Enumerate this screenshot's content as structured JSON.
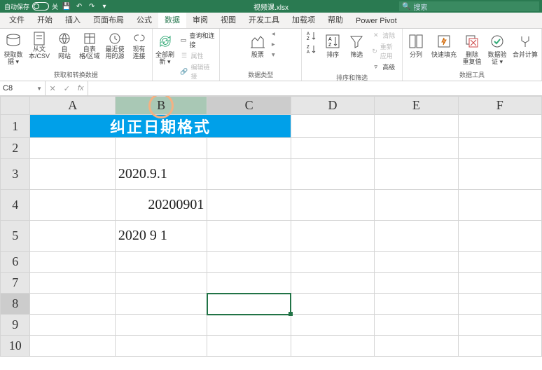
{
  "titlebar": {
    "autosave_label": "自动保存",
    "autosave_state": "关",
    "filename": "视频课.xlsx",
    "search_placeholder": "搜索"
  },
  "tabs": {
    "file": "文件",
    "home": "开始",
    "insert": "插入",
    "layout": "页面布局",
    "formulas": "公式",
    "data": "数据",
    "review": "审阅",
    "view": "视图",
    "dev": "开发工具",
    "addins": "加载项",
    "help": "帮助",
    "powerpivot": "Power Pivot"
  },
  "ribbon": {
    "group1": {
      "get_data": "获取数\n据 ▾",
      "from_csv": "从文\n本/CSV",
      "from_web": "自\n网站",
      "from_table": "自表\n格/区域",
      "recent": "最近使\n用的源",
      "existing": "现有\n连接",
      "label": "获取和转换数据"
    },
    "group2": {
      "refresh": "全部刷\n新 ▾",
      "queries": "查询和连接",
      "properties": "属性",
      "edit_links": "编辑链接",
      "label": "查询和连接"
    },
    "group3": {
      "stocks": "股票",
      "label": "数据类型"
    },
    "group4": {
      "sort_asc": "A↓Z",
      "sort_desc": "Z↓A",
      "sort": "排序",
      "filter": "筛选",
      "clear": "清除",
      "reapply": "重新应用",
      "advanced": "高级",
      "label": "排序和筛选"
    },
    "group5": {
      "text_columns": "分列",
      "flash_fill": "快速填充",
      "remove_dup": "删除\n重复值",
      "data_val": "数据验\n证 ▾",
      "consolidate": "合并计算",
      "label": "数据工具"
    }
  },
  "namebox": "C8",
  "formula": "",
  "columns": [
    "A",
    "B",
    "C",
    "D",
    "E",
    "F"
  ],
  "rows": [
    "1",
    "2",
    "3",
    "4",
    "5",
    "6",
    "7",
    "8",
    "9",
    "10"
  ],
  "cells": {
    "title_merged": "纠正日期格式",
    "B3": "2020.9.1",
    "B4": "20200901",
    "B5": "2020 9 1"
  },
  "chart_data": {
    "type": "table",
    "title": "纠正日期格式",
    "columns": [
      "B"
    ],
    "rows": [
      {
        "row": 3,
        "B": "2020.9.1"
      },
      {
        "row": 4,
        "B": "20200901"
      },
      {
        "row": 5,
        "B": "2020 9 1"
      }
    ]
  }
}
